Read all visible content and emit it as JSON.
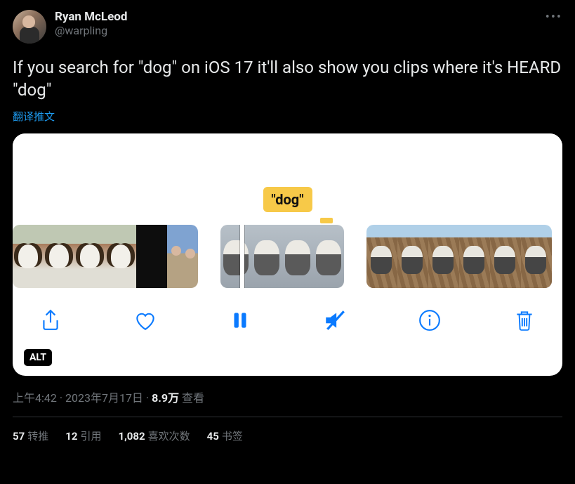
{
  "author": {
    "display_name": "Ryan McLeod",
    "handle": "@warpling"
  },
  "tweet_text": "If you search for \"dog\" on iOS 17 it'll also show you clips where it's HEARD \"dog\"",
  "translate_label": "翻译推文",
  "media": {
    "overlay_label": "\"dog\"",
    "alt_badge": "ALT"
  },
  "meta": {
    "time": "上午4:42",
    "date": "2023年7月17日",
    "views_num": "8.9万",
    "views_label": "查看"
  },
  "stats": {
    "retweets_num": "57",
    "retweets_label": "转推",
    "quotes_num": "12",
    "quotes_label": "引用",
    "likes_num": "1,082",
    "likes_label": "喜欢次数",
    "bookmarks_num": "45",
    "bookmarks_label": "书签"
  }
}
